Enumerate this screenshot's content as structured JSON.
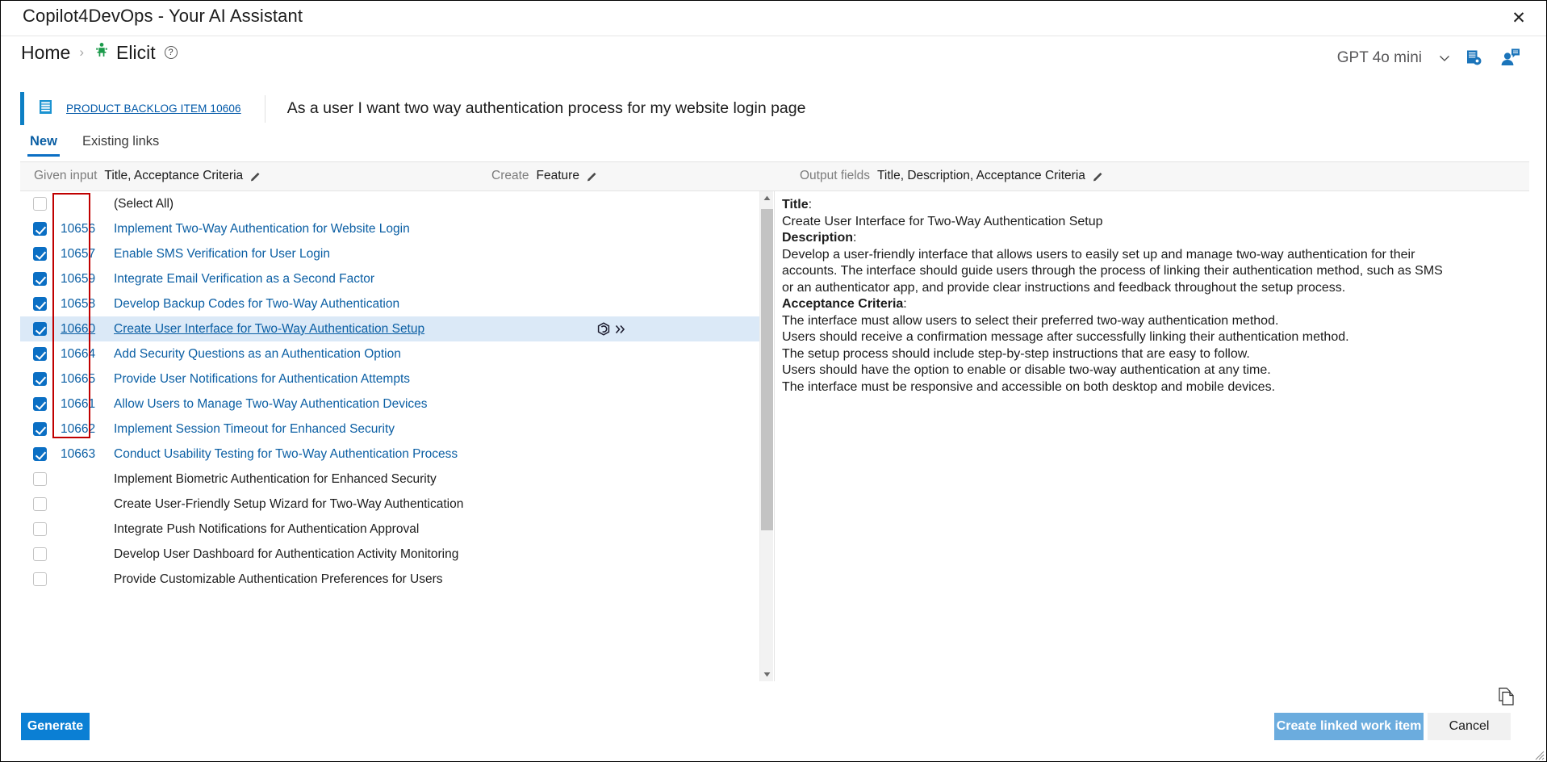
{
  "window": {
    "title": "Copilot4DevOps - Your AI Assistant",
    "close_label": "✕"
  },
  "breadcrumb": {
    "home": "Home",
    "separator": "›",
    "current": "Elicit",
    "help": "?"
  },
  "header_right": {
    "model": "GPT 4o mini",
    "chevron": "∨"
  },
  "work_item": {
    "id_link": "PRODUCT BACKLOG ITEM 10606",
    "title": "As a user I want two way authentication process for my website login page",
    "accent_color": "#0d7fc4"
  },
  "tabs": [
    {
      "label": "New",
      "active": true
    },
    {
      "label": "Existing links",
      "active": false
    }
  ],
  "field_bar": {
    "given_input_label": "Given input",
    "given_input_value": "Title, Acceptance Criteria",
    "create_label": "Create",
    "create_value": "Feature",
    "output_fields_label": "Output fields",
    "output_fields_value": "Title, Description, Acceptance Criteria"
  },
  "list": {
    "select_all_label": "(Select All)",
    "rows": [
      {
        "id": "10656",
        "title": "Implement Two-Way Authentication for Website Login",
        "checked": true,
        "selected": false
      },
      {
        "id": "10657",
        "title": "Enable SMS Verification for User Login",
        "checked": true,
        "selected": false
      },
      {
        "id": "10659",
        "title": "Integrate Email Verification as a Second Factor",
        "checked": true,
        "selected": false
      },
      {
        "id": "10658",
        "title": "Develop Backup Codes for Two-Way Authentication",
        "checked": true,
        "selected": false
      },
      {
        "id": "10660",
        "title": "Create User Interface for Two-Way Authentication Setup",
        "checked": true,
        "selected": true
      },
      {
        "id": "10664",
        "title": "Add Security Questions as an Authentication Option",
        "checked": true,
        "selected": false
      },
      {
        "id": "10665",
        "title": "Provide User Notifications for Authentication Attempts",
        "checked": true,
        "selected": false
      },
      {
        "id": "10661",
        "title": "Allow Users to Manage Two-Way Authentication Devices",
        "checked": true,
        "selected": false
      },
      {
        "id": "10662",
        "title": "Implement Session Timeout for Enhanced Security",
        "checked": true,
        "selected": false
      },
      {
        "id": "10663",
        "title": "Conduct Usability Testing for Two-Way Authentication Process",
        "checked": true,
        "selected": false
      },
      {
        "id": "",
        "title": "Implement Biometric Authentication for Enhanced Security",
        "checked": false,
        "selected": false
      },
      {
        "id": "",
        "title": "Create User-Friendly Setup Wizard for Two-Way Authentication",
        "checked": false,
        "selected": false
      },
      {
        "id": "",
        "title": "Integrate Push Notifications for Authentication Approval",
        "checked": false,
        "selected": false
      },
      {
        "id": "",
        "title": "Develop User Dashboard for Authentication Activity Monitoring",
        "checked": false,
        "selected": false
      },
      {
        "id": "",
        "title": "Provide Customizable Authentication Preferences for Users",
        "checked": false,
        "selected": false
      }
    ],
    "annotation_color": "#c00000"
  },
  "detail": {
    "title_heading": "Title",
    "title_value": "Create User Interface for Two-Way Authentication Setup",
    "description_heading": "Description",
    "description_lines": [
      "Develop a user-friendly interface that allows users to easily set up and manage two-way authentication for their",
      "accounts. The interface should guide users through the process of linking their authentication method, such as SMS",
      "or an authenticator app, and provide clear instructions and feedback throughout the setup process."
    ],
    "acceptance_heading": "Acceptance Criteria",
    "acceptance_lines": [
      "The interface must allow users to select their preferred two-way authentication method.",
      "Users should receive a confirmation message after successfully linking their authentication method.",
      "The setup process should include step-by-step instructions that are easy to follow.",
      "Users should have the option to enable or disable two-way authentication at any time.",
      "The interface must be responsive and accessible on both desktop and mobile devices."
    ]
  },
  "footer": {
    "generate_label": "Generate",
    "create_linked_label": "Create linked work item",
    "cancel_label": "Cancel"
  },
  "colors": {
    "accent_blue": "#0b7fd4",
    "link_blue": "#0b5fa4",
    "selected_row": "#dbe9f7",
    "disabled_button": "#6bacde",
    "annotation_red": "#c00000"
  }
}
